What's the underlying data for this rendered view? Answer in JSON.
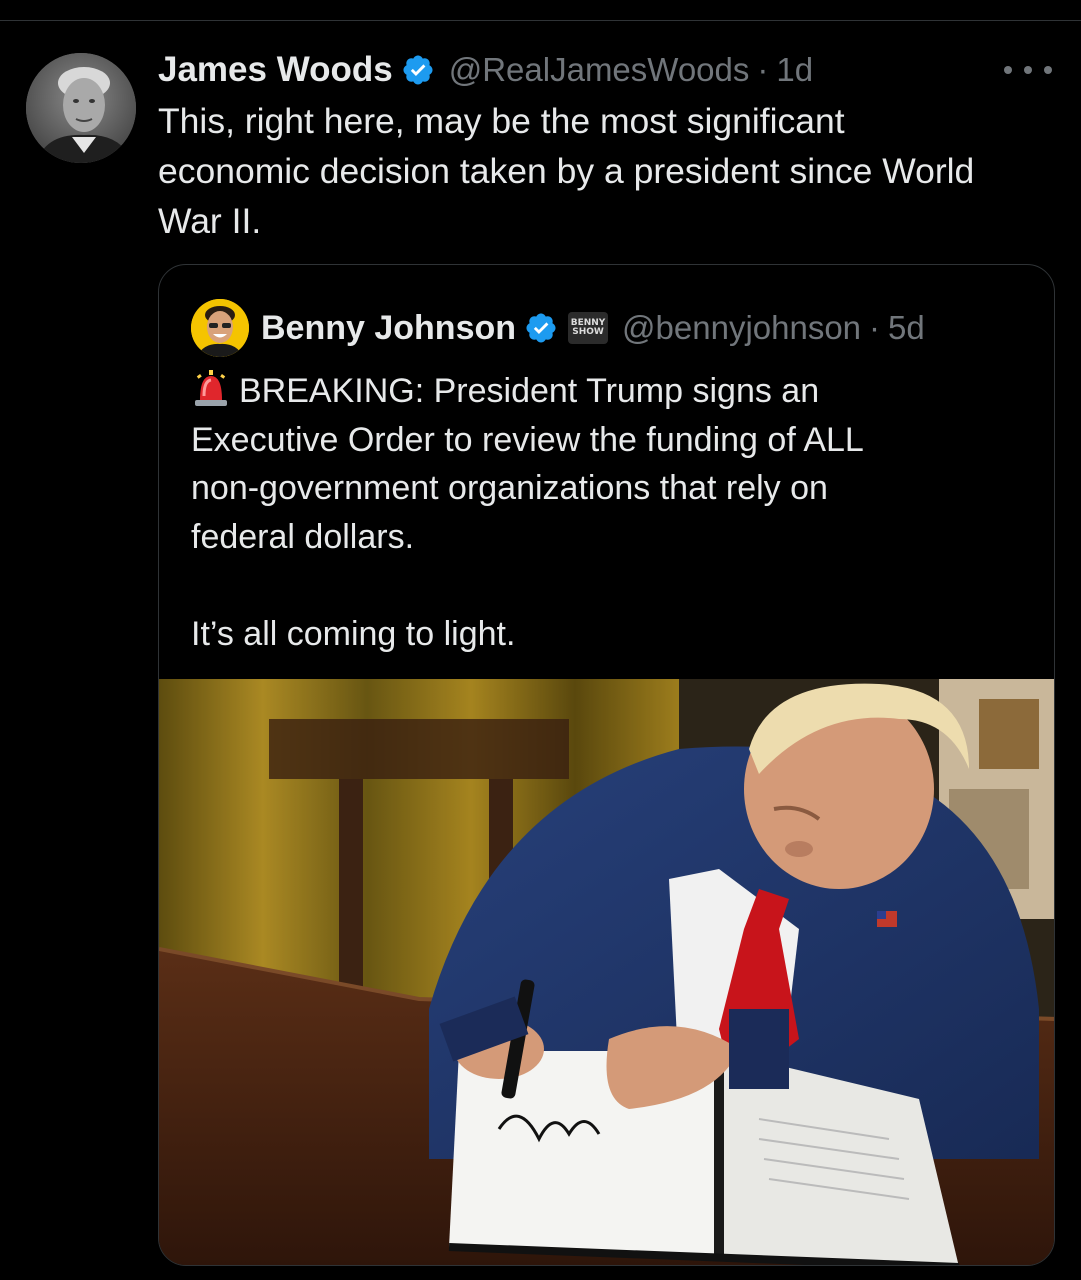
{
  "tweet": {
    "author_name": "James Woods",
    "author_handle": "@RealJamesWoods",
    "separator": "·",
    "time": "1d",
    "text": "This, right here, may be the most significant\neconomic decision taken by a president since World\nWar II."
  },
  "quote": {
    "author_name": "Benny Johnson",
    "badge_text_1": "BENNY",
    "badge_text_2": "SHOW",
    "author_handle": "@bennyjohnson",
    "separator": "·",
    "time": "5d",
    "lines": [
      "BREAKING: President Trump signs an",
      "Executive Order to review the funding of ALL",
      "non-government organizations that rely on",
      "federal dollars."
    ],
    "closing_line": "It’s all coming to light."
  },
  "icons": {
    "verified": "verified-badge-icon",
    "more": "more-options-icon",
    "siren": "police-light-emoji"
  },
  "colors": {
    "background": "#000000",
    "text_primary": "#e7e9ea",
    "text_secondary": "#71767b",
    "verified_blue": "#1d9bf0",
    "border": "#2f3336"
  }
}
